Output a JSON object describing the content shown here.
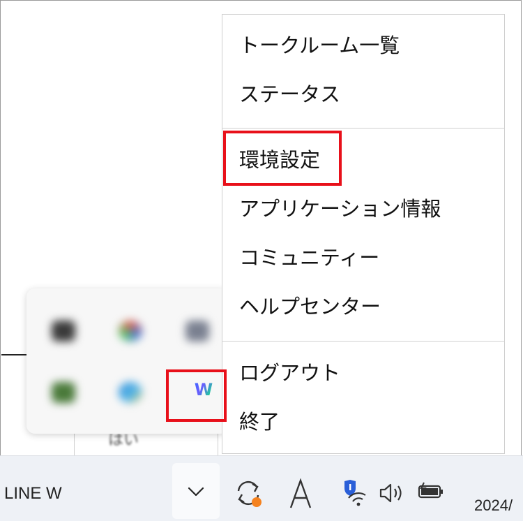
{
  "menu": {
    "items": [
      {
        "label": "トークルーム一覧"
      },
      {
        "label": "ステータス"
      },
      {
        "label": "環境設定"
      },
      {
        "label": "アプリケーション情報"
      },
      {
        "label": "コミュニティー"
      },
      {
        "label": "ヘルプセンター"
      },
      {
        "label": "ログアウト"
      },
      {
        "label": "終了"
      }
    ]
  },
  "background": {
    "card_text": "はい"
  },
  "tray": {
    "icons": [
      {
        "name": "blurred-app-1-icon",
        "color": "#3a3a3a"
      },
      {
        "name": "blurred-app-2-icon",
        "color": "#d86a5a"
      },
      {
        "name": "blurred-app-3-icon",
        "color": "#7a8090"
      },
      {
        "name": "blurred-app-4-icon",
        "color": "#5a8a4a"
      },
      {
        "name": "blurred-app-5-icon",
        "color": "#3a9ad8"
      },
      {
        "name": "line-works-icon",
        "glyph": "W"
      }
    ]
  },
  "taskbar": {
    "app_label": "LINE W",
    "clock": "2024/"
  },
  "colors": {
    "highlight": "#e8101a",
    "update_badge": "#f5821f",
    "shield": "#2a5fd8"
  }
}
